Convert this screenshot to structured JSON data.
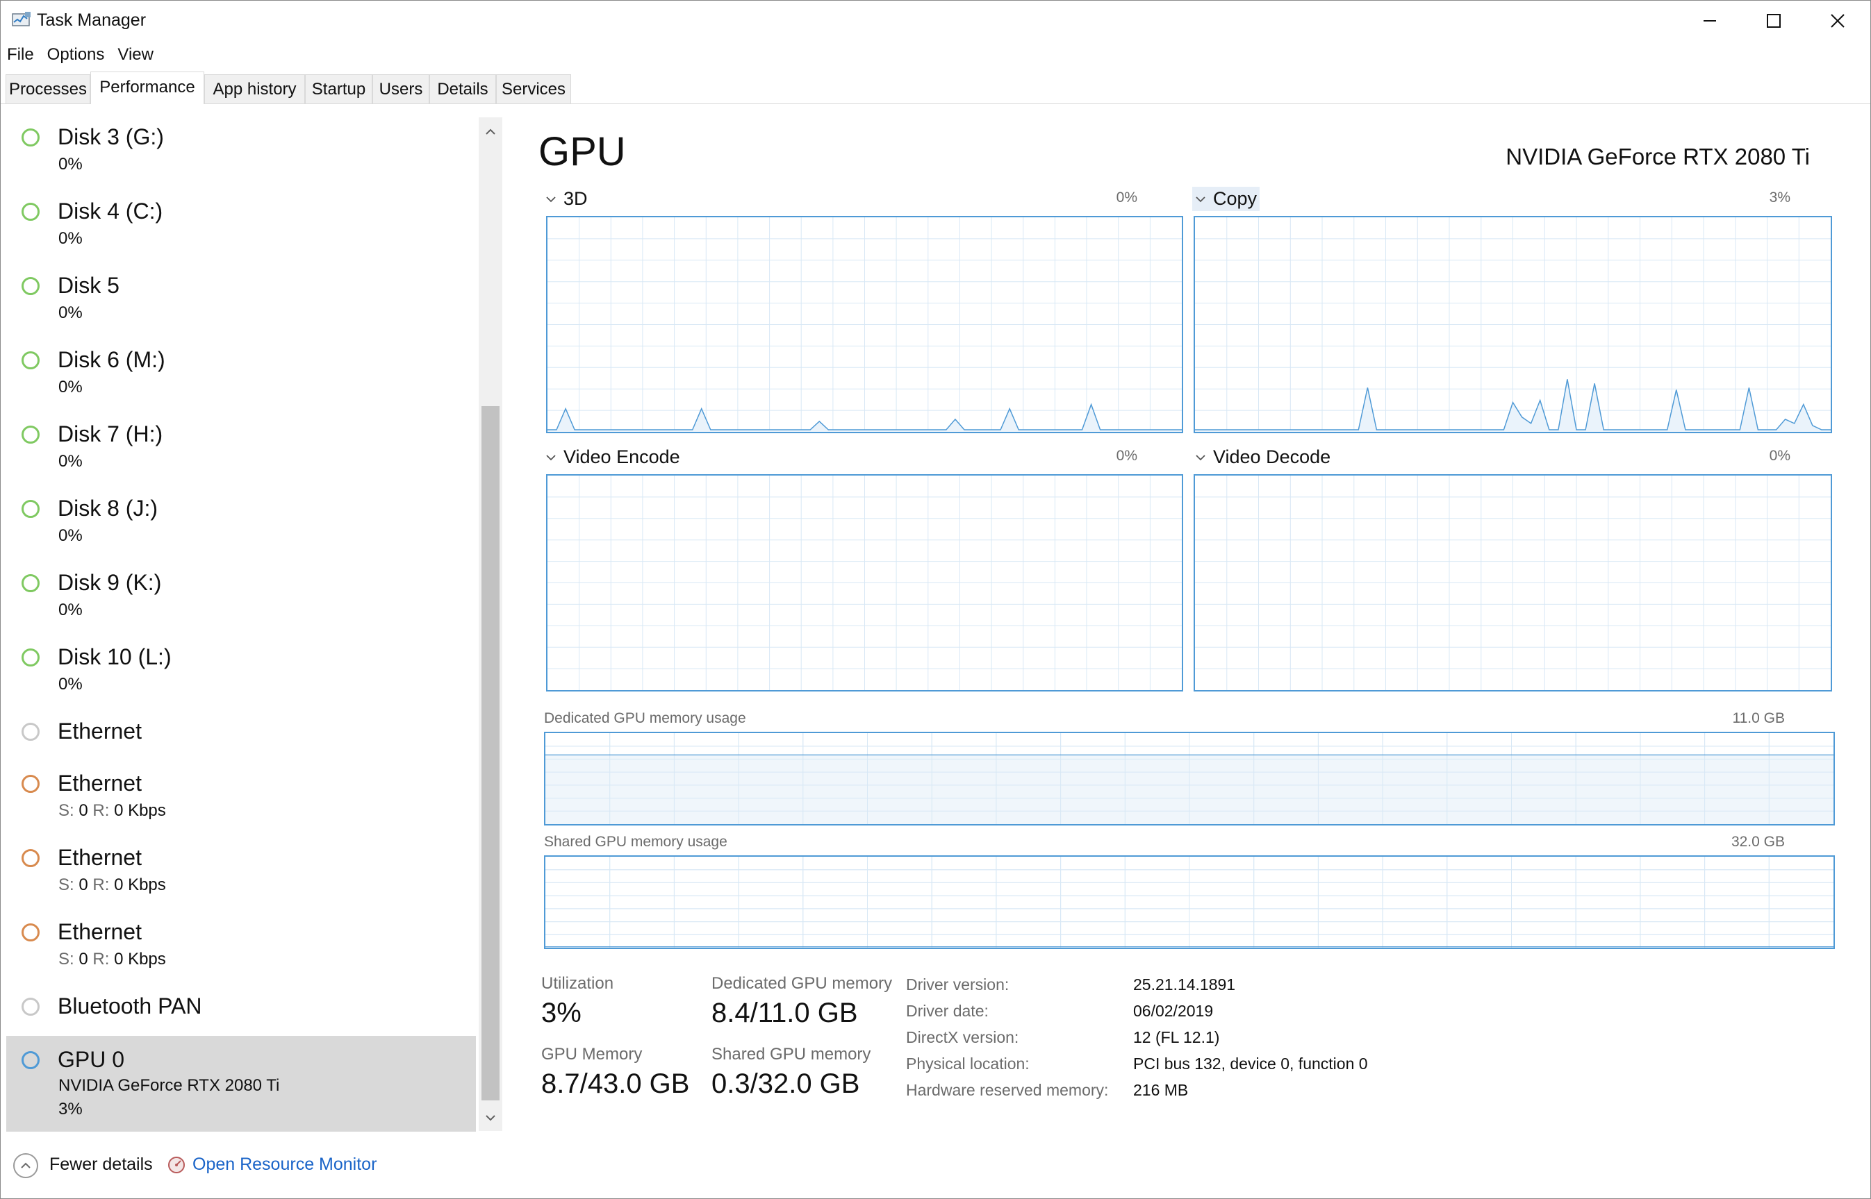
{
  "window": {
    "title": "Task Manager",
    "icon": "task-manager-icon",
    "controls": [
      "minimize-icon",
      "maximize-icon",
      "close-icon"
    ]
  },
  "menu": [
    "File",
    "Options",
    "View"
  ],
  "tabs": [
    {
      "label": "Processes",
      "active": false
    },
    {
      "label": "Performance",
      "active": true
    },
    {
      "label": "App history",
      "active": false
    },
    {
      "label": "Startup",
      "active": false
    },
    {
      "label": "Users",
      "active": false
    },
    {
      "label": "Details",
      "active": false
    },
    {
      "label": "Services",
      "active": false
    }
  ],
  "sidebar": {
    "items": [
      {
        "name": "Disk 3 (G:)",
        "sub": "0%",
        "dot_color": "#7fc961"
      },
      {
        "name": "Disk 4 (C:)",
        "sub": "0%",
        "dot_color": "#7fc961"
      },
      {
        "name": "Disk 5",
        "sub": "0%",
        "dot_color": "#7fc961"
      },
      {
        "name": "Disk 6 (M:)",
        "sub": "0%",
        "dot_color": "#7fc961"
      },
      {
        "name": "Disk 7 (H:)",
        "sub": "0%",
        "dot_color": "#7fc961"
      },
      {
        "name": "Disk 8 (J:)",
        "sub": "0%",
        "dot_color": "#7fc961"
      },
      {
        "name": "Disk 9 (K:)",
        "sub": "0%",
        "dot_color": "#7fc961"
      },
      {
        "name": "Disk 10 (L:)",
        "sub": "0%",
        "dot_color": "#7fc961"
      },
      {
        "name": "Ethernet",
        "sub": "",
        "dot_color": "#c8c8c8"
      },
      {
        "name": "Ethernet",
        "sub_s_label": "S:",
        "sub_s_value": "0",
        "sub_r_label": "R:",
        "sub_r_value": "0 Kbps",
        "dot_color": "#d88a4e"
      },
      {
        "name": "Ethernet",
        "sub_s_label": "S:",
        "sub_s_value": "0",
        "sub_r_label": "R:",
        "sub_r_value": "0 Kbps",
        "dot_color": "#d88a4e"
      },
      {
        "name": "Ethernet",
        "sub_s_label": "S:",
        "sub_s_value": "0",
        "sub_r_label": "R:",
        "sub_r_value": "0 Kbps",
        "dot_color": "#d88a4e"
      },
      {
        "name": "Bluetooth PAN",
        "sub": "",
        "dot_color": "#c8c8c8"
      },
      {
        "name": "GPU 0",
        "sub": "NVIDIA GeForce RTX 2080 Ti",
        "sub2": "3%",
        "dot_color": "#4f9ad6",
        "selected": true
      }
    ]
  },
  "footer": {
    "fewer_details": "Fewer details",
    "open_resource_monitor": "Open Resource Monitor"
  },
  "main": {
    "title": "GPU",
    "model": "NVIDIA GeForce RTX 2080 Ti",
    "engines": [
      {
        "label": "3D",
        "percent": "0%",
        "samples": [
          0,
          0,
          0.1,
          0,
          0,
          0,
          0,
          0,
          0,
          0,
          0,
          0,
          0,
          0,
          0,
          0,
          0,
          0.1,
          0,
          0,
          0,
          0,
          0,
          0,
          0,
          0,
          0,
          0,
          0,
          0,
          0.04,
          0,
          0,
          0,
          0,
          0,
          0,
          0,
          0,
          0,
          0,
          0,
          0,
          0,
          0,
          0.05,
          0,
          0,
          0,
          0,
          0,
          0.1,
          0,
          0,
          0,
          0,
          0,
          0,
          0,
          0,
          0.12,
          0,
          0,
          0,
          0,
          0,
          0,
          0,
          0,
          0,
          0
        ]
      },
      {
        "label": "Copy",
        "percent": "3%",
        "selected": true,
        "samples": [
          0,
          0,
          0,
          0,
          0,
          0,
          0,
          0,
          0,
          0,
          0,
          0,
          0,
          0,
          0,
          0,
          0,
          0,
          0,
          0.2,
          0,
          0,
          0,
          0,
          0,
          0,
          0,
          0,
          0,
          0,
          0,
          0,
          0,
          0,
          0,
          0.13,
          0.06,
          0.03,
          0.14,
          0,
          0,
          0.24,
          0,
          0,
          0.22,
          0,
          0,
          0,
          0,
          0,
          0,
          0,
          0,
          0.19,
          0,
          0,
          0,
          0,
          0,
          0,
          0,
          0.2,
          0,
          0,
          0,
          0.05,
          0.03,
          0.12,
          0.02,
          0,
          0
        ]
      },
      {
        "label": "Video Encode",
        "percent": "0%",
        "samples": []
      },
      {
        "label": "Video Decode",
        "percent": "0%",
        "samples": []
      }
    ],
    "dedicated_memory": {
      "label": "Dedicated GPU memory usage",
      "max": "11.0 GB",
      "fraction": 0.76
    },
    "shared_memory": {
      "label": "Shared GPU memory usage",
      "max": "32.0 GB",
      "fraction": 0.01
    },
    "stats": {
      "utilization_label": "Utilization",
      "utilization_value": "3%",
      "dedicated_label": "Dedicated GPU memory",
      "dedicated_value": "8.4/11.0 GB",
      "gpu_memory_label": "GPU Memory",
      "gpu_memory_value": "8.7/43.0 GB",
      "shared_label": "Shared GPU memory",
      "shared_value": "0.3/32.0 GB"
    },
    "info": [
      {
        "label": "Driver version:",
        "value": "25.21.14.1891"
      },
      {
        "label": "Driver date:",
        "value": "06/02/2019"
      },
      {
        "label": "DirectX version:",
        "value": "12 (FL 12.1)"
      },
      {
        "label": "Physical location:",
        "value": "PCI bus 132, device 0, function 0"
      },
      {
        "label": "Hardware reserved memory:",
        "value": "216 MB"
      }
    ]
  },
  "colors": {
    "graph_border": "#4f9ad6",
    "grid": "#d8e8f5",
    "memory_fill": "#edf4fa",
    "link": "#1a64c8",
    "selected_bg": "#d9d9d9"
  }
}
